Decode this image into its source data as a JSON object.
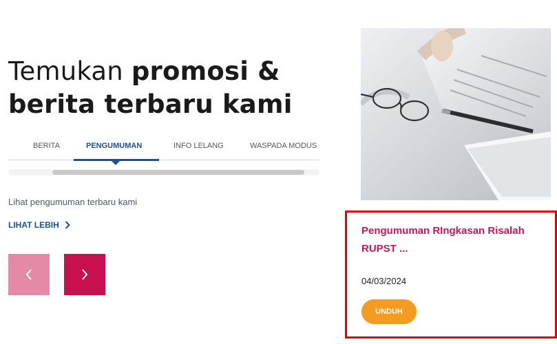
{
  "headline": {
    "line1_light": "Temukan ",
    "line1_bold": "promosi &",
    "line2_bold": "berita terbaru kami"
  },
  "tabs": [
    {
      "label": "BERITA",
      "active": false
    },
    {
      "label": "PENGUMUMAN",
      "active": true
    },
    {
      "label": "INFO LELANG",
      "active": false
    },
    {
      "label": "WASPADA MODUS",
      "active": false
    }
  ],
  "section": {
    "subtitle": "Lihat pengumuman terbaru kami",
    "more_label": "LIHAT LEBIH"
  },
  "carousel": {
    "prev_icon": "chevron-left-icon",
    "next_icon": "chevron-right-icon"
  },
  "card": {
    "title": "Pengumuman RIngkasan Risalah RUPST ...",
    "date": "04/03/2024",
    "download_label": "UNDUH"
  },
  "colors": {
    "brand_blue": "#1f4f8f",
    "brand_magenta": "#c8104f",
    "accent_orange": "#f39c1f",
    "highlight_red": "#e60000"
  }
}
